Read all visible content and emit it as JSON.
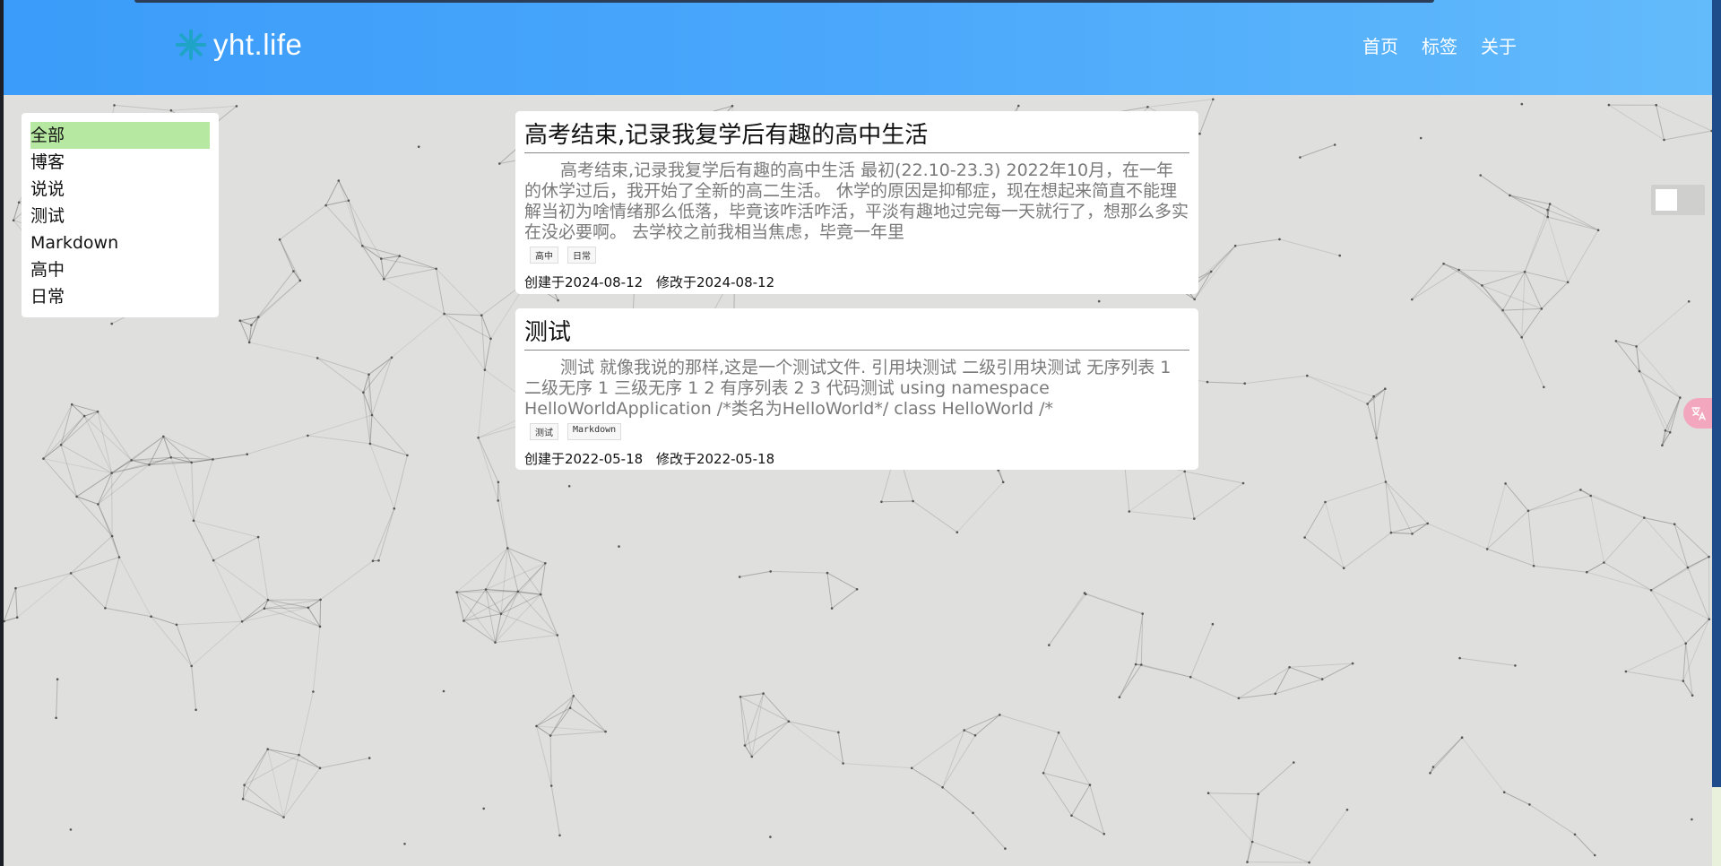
{
  "site": {
    "logo_text": "yht.life"
  },
  "nav": {
    "items": [
      {
        "label": "首页"
      },
      {
        "label": "标签"
      },
      {
        "label": "关于"
      }
    ]
  },
  "categories": {
    "items": [
      {
        "label": "全部",
        "active": true
      },
      {
        "label": "博客",
        "active": false
      },
      {
        "label": "说说",
        "active": false
      },
      {
        "label": "测试",
        "active": false
      },
      {
        "label": "Markdown",
        "active": false
      },
      {
        "label": "高中",
        "active": false
      },
      {
        "label": "日常",
        "active": false
      }
    ]
  },
  "posts": [
    {
      "title": "高考结束,记录我复学后有趣的高中生活",
      "excerpt": "高考结束,记录我复学后有趣的高中生活 最初(22.10-23.3) 2022年10月，在一年的休学过后，我开始了全新的高二生活。 休学的原因是抑郁症，现在想起来简直不能理解当初为啥情绪那么低落，毕竟该咋活咋活，平淡有趣地过完每一天就行了，想那么多实在没必要啊。 去学校之前我相当焦虑，毕竟一年里",
      "tags": [
        "高中",
        "日常"
      ],
      "created": "创建于2024-08-12",
      "modified": "修改于2024-08-12"
    },
    {
      "title": "测试",
      "excerpt": "测试 就像我说的那样,这是一个测试文件. 引用块测试 二级引用块测试 无序列表 1 二级无序 1 三级无序 1 2 有序列表 2 3 代码测试 using namespace HelloWorldApplication /*类名为HelloWorld*/ class HelloWorld /*",
      "tags": [
        "测试",
        "Markdown"
      ],
      "created": "创建于2022-05-18",
      "modified": "修改于2022-05-18"
    }
  ],
  "colors": {
    "header_start": "#3b9cf9",
    "header_end": "#63bbfb",
    "logo_icon": "#1fa4c8",
    "active_category": "#b6e8a2",
    "background": "#dfe0dd"
  },
  "icons": {
    "logo": "snowflake-icon",
    "translate": "translate-icon"
  }
}
